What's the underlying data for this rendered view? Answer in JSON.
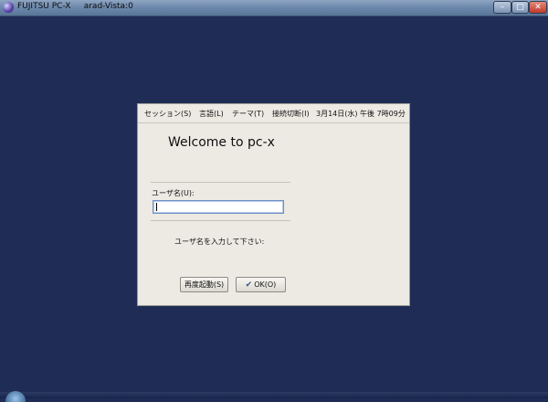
{
  "window": {
    "title": "FUJITSU PC-X     arad-Vista:0",
    "icon": "app-icon",
    "controls": {
      "minimize": "–",
      "maximize": "□",
      "close": "✕"
    }
  },
  "menubar": {
    "items": [
      {
        "label": "セッション(S)"
      },
      {
        "label": "言語(L)"
      },
      {
        "label": "テーマ(T)"
      },
      {
        "label": "接続切断(I)"
      }
    ],
    "clock": "3月14日(水) 午後 7時09分"
  },
  "login": {
    "welcome": "Welcome to pc-x",
    "username_label": "ユーザ名(U):",
    "username_value": "",
    "prompt": "ユーザ名を入力して下さい:",
    "restart_button": "再度起動(S)",
    "ok_button": "OK(O)",
    "ok_icon": "ok-check-icon"
  },
  "colors": {
    "desktop": "#1f2d56",
    "dialog_bg": "#edeae3"
  }
}
